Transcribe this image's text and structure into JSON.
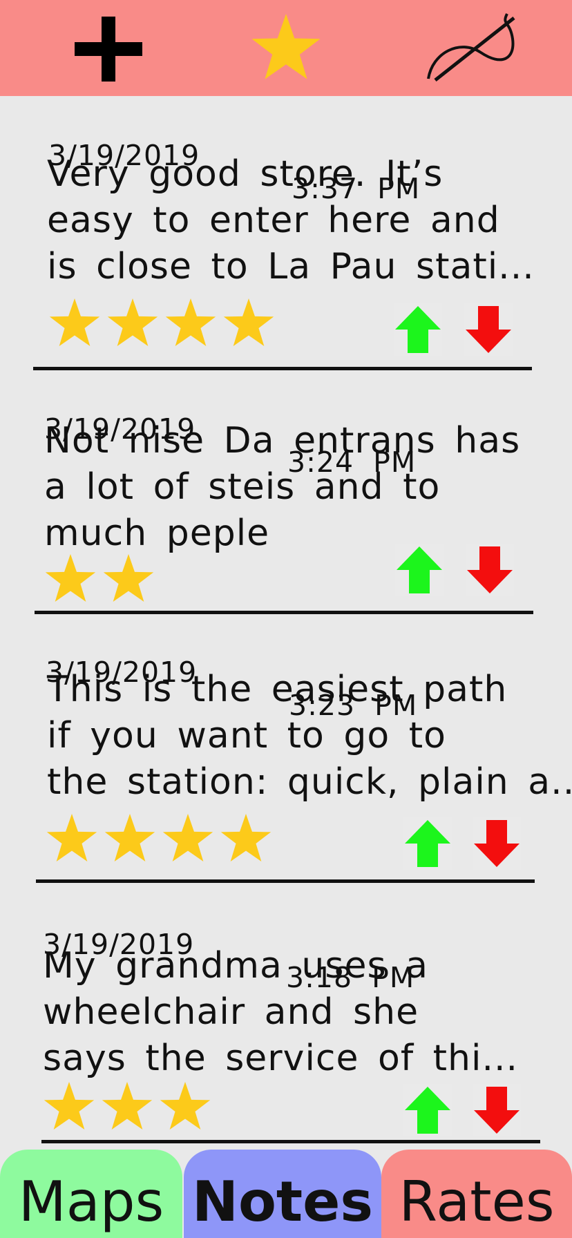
{
  "colors": {
    "topbar": "#f98b88",
    "background": "#e9e9e9",
    "star": "#fcca1a",
    "upvote": "#1cf51c",
    "downvote": "#f30e0e",
    "tab_maps": "#8efa9e",
    "tab_notes": "#8e96f8",
    "tab_rates": "#f98b88"
  },
  "topbar": {
    "icons": [
      "plus-icon",
      "star-icon",
      "route-curve-icon"
    ]
  },
  "reviews": [
    {
      "date": "3/19/2019",
      "time": "3:37  PM",
      "lines": [
        "Very good store. It’s",
        "easy to enter here and",
        "is close to La Pau stati..."
      ],
      "rating": 4
    },
    {
      "date": "3/19/2019",
      "time": "3:24  PM",
      "lines": [
        "Not nise Da entrans has",
        "a lot of steis and to",
        "much peple"
      ],
      "rating": 2
    },
    {
      "date": "3/19/2019",
      "time": "3:23  PM",
      "lines": [
        "This is the easiest path",
        "if you want to go to",
        "the station: quick, plain a..."
      ],
      "rating": 4
    },
    {
      "date": "3/19/2019",
      "time": "3:18  PM",
      "lines": [
        "My grandma uses a",
        "wheelchair and she",
        "says the service of thi..."
      ],
      "rating": 3
    }
  ],
  "tabs": {
    "maps": "Maps",
    "notes": "Notes",
    "rates": "Rates"
  }
}
